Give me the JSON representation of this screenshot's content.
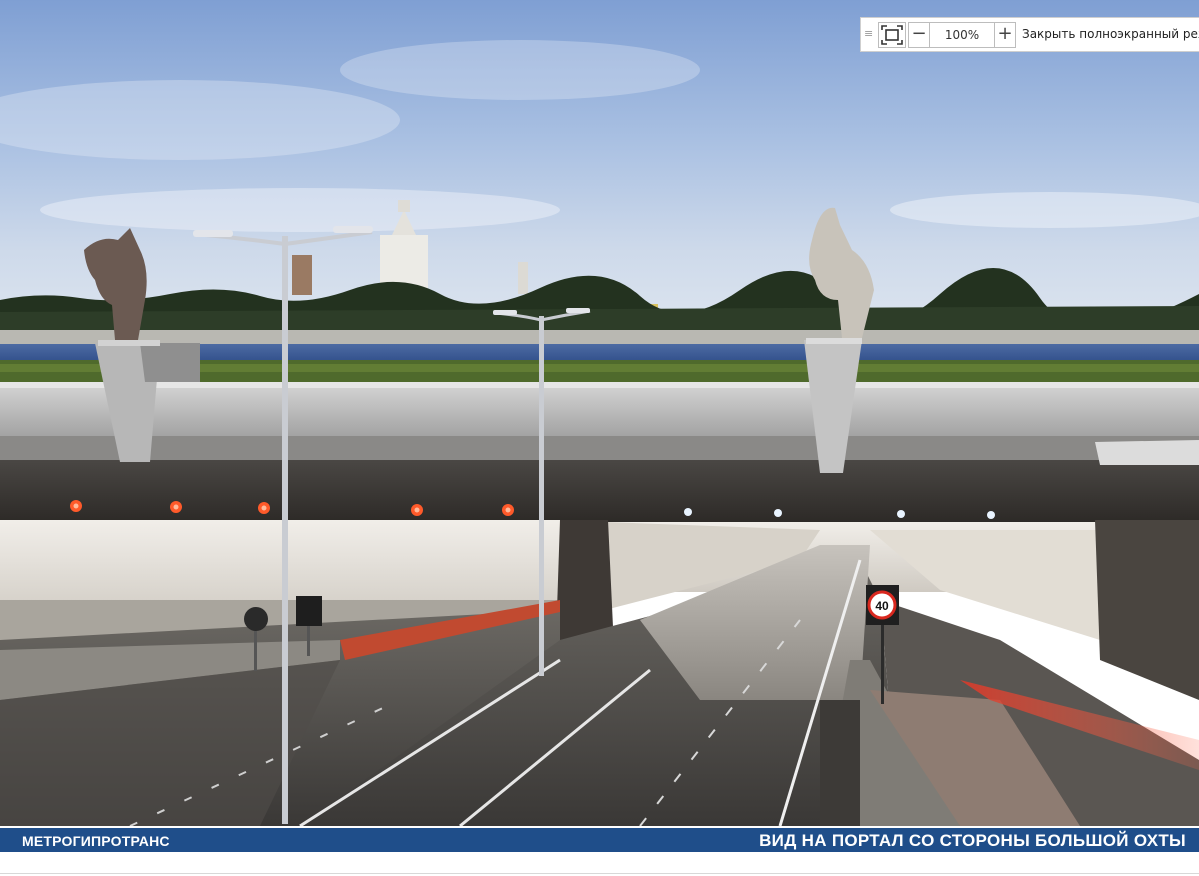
{
  "toolbar": {
    "grip_icon": "drag-handle-icon",
    "fit_icon": "fit-to-screen-icon",
    "zoom_out_label": "−",
    "zoom_value": "100%",
    "zoom_in_label": "+",
    "exit_fullscreen_label": "Закрыть полноэкранный реж"
  },
  "caption": {
    "left": "МЕТРОГИПРОТРАНС",
    "right": "ВИД НА ПОРТАЛ СО СТОРОНЫ БОЛЬШОЙ ОХТЫ",
    "background_color": "#1f4e8a",
    "text_color": "#ffffff"
  },
  "scene": {
    "speed_sign": "40"
  }
}
